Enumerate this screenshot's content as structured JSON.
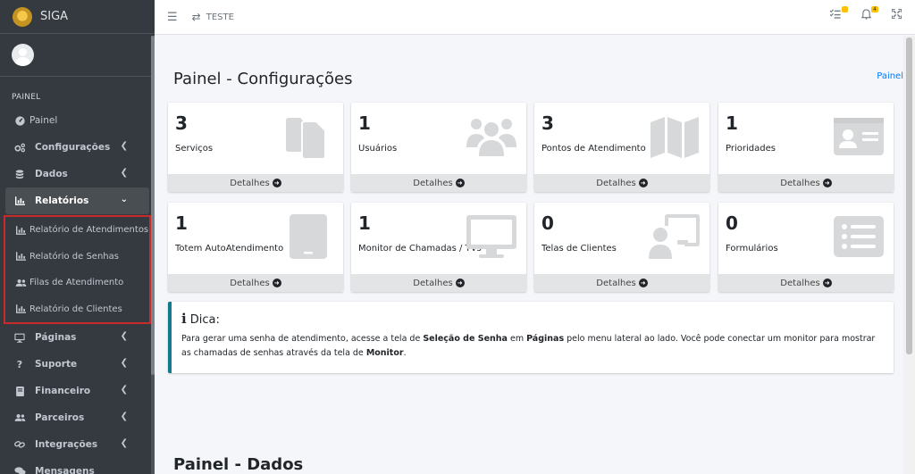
{
  "app": {
    "brand": "SIGA"
  },
  "sidebar": {
    "header": "PAINEL",
    "items": [
      {
        "label": "Painel",
        "icon": "dashboard-icon"
      },
      {
        "label": "Configurações",
        "icon": "gears-icon"
      },
      {
        "label": "Dados",
        "icon": "database-icon"
      },
      {
        "label": "Relatórios",
        "icon": "chart-icon"
      }
    ],
    "sub_items": [
      {
        "label": "Relatório de Atendimentos",
        "icon": "chart-icon"
      },
      {
        "label": "Relatório de Senhas",
        "icon": "chart-icon"
      },
      {
        "label": "Filas de Atendimento",
        "icon": "users-icon"
      },
      {
        "label": "Relatório de Clientes",
        "icon": "chart-icon"
      }
    ],
    "items_after": [
      {
        "label": "Páginas",
        "icon": "monitor-icon"
      },
      {
        "label": "Suporte",
        "icon": "question-icon"
      },
      {
        "label": "Financeiro",
        "icon": "book-icon"
      },
      {
        "label": "Parceiros",
        "icon": "users-icon"
      },
      {
        "label": "Integrações",
        "icon": "link-icon"
      },
      {
        "label": "Mensagens",
        "icon": "comments-icon"
      }
    ]
  },
  "topbar": {
    "unit_label": "TESTE",
    "tasks_badge": "",
    "notifications_badge": "4"
  },
  "main": {
    "title": "Painel - Configurações",
    "breadcrumb": "Painel",
    "details_label": "Detalhes",
    "boxes": [
      {
        "count": "3",
        "label": "Serviços",
        "icon": "copy-icon"
      },
      {
        "count": "1",
        "label": "Usuários",
        "icon": "users-icon"
      },
      {
        "count": "3",
        "label": "Pontos de Atendimento",
        "icon": "map-icon"
      },
      {
        "count": "1",
        "label": "Prioridades",
        "icon": "id-card-icon"
      },
      {
        "count": "1",
        "label": "Totem AutoAtendimento",
        "icon": "tablet-icon"
      },
      {
        "count": "1",
        "label": "Monitor de Chamadas / TVs",
        "icon": "desktop-icon"
      },
      {
        "count": "0",
        "label": "Telas de Clientes",
        "icon": "chalkboard-user-icon"
      },
      {
        "count": "0",
        "label": "Formulários",
        "icon": "list-icon"
      }
    ],
    "tip": {
      "title": "Dica:",
      "p1": "Para gerar uma senha de atendimento, acesse a tela de ",
      "b1": "Seleção de Senha",
      "p2": " em ",
      "b2": "Páginas",
      "p3": " pelo menu lateral ao lado. Você pode conectar um monitor para mostrar as chamadas de senhas através da tela de ",
      "b3": "Monitor",
      "p4": "."
    },
    "title2": "Painel - Dados"
  },
  "colors": {
    "sidebar_bg": "#343a40",
    "accent": "#007bff",
    "highlight_border": "#c92a2a",
    "callout_border": "#117a8b",
    "badge": "#ffc107"
  }
}
